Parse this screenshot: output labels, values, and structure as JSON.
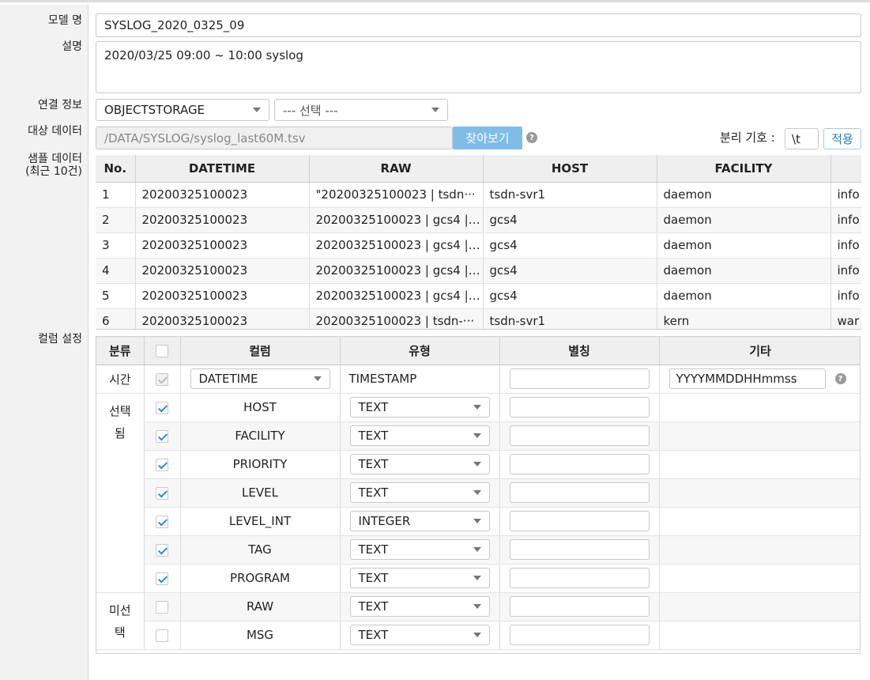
{
  "labels": {
    "model_name": "모델 명",
    "description": "설명",
    "connection": "연결 정보",
    "target_data": "대상 데이터",
    "sample_data_1": "샘플 데이터",
    "sample_data_2": "(최근 10건)",
    "column_settings": "컬럼 설정"
  },
  "form": {
    "model_name_value": "SYSLOG_2020_0325_09",
    "description_value": "2020/03/25 09:00 ~ 10:00 syslog",
    "connection_type": "OBJECTSTORAGE",
    "connection_select": "--- 선택 ---",
    "target_path": "/DATA/SYSLOG/syslog_last60M.tsv",
    "browse_button": "찾아보기",
    "help_glyph": "?",
    "delimiter_label": "분리 기호 :",
    "delimiter_value": "\\t",
    "apply_button": "적용"
  },
  "sample_table": {
    "headers": [
      "No.",
      "DATETIME",
      "RAW",
      "HOST",
      "FACILITY",
      ""
    ],
    "rows": [
      [
        "1",
        "20200325100023",
        "\"20200325100023 | tsdn···",
        "tsdn-svr1",
        "daemon",
        "info"
      ],
      [
        "2",
        "20200325100023",
        "20200325100023 | gcs4 | ···",
        "gcs4",
        "daemon",
        "info"
      ],
      [
        "3",
        "20200325100023",
        "20200325100023 | gcs4 | ···",
        "gcs4",
        "daemon",
        "info"
      ],
      [
        "4",
        "20200325100023",
        "20200325100023 | gcs4 | ···",
        "gcs4",
        "daemon",
        "info"
      ],
      [
        "5",
        "20200325100023",
        "20200325100023 | gcs4 | ···",
        "gcs4",
        "daemon",
        "info"
      ],
      [
        "6",
        "20200325100023",
        "20200325100023 | tsdn-···",
        "tsdn-svr1",
        "kern",
        "war"
      ]
    ]
  },
  "columns_table": {
    "headers": [
      "분류",
      "",
      "컬럼",
      "유형",
      "별칭",
      "기타"
    ],
    "time_category": "시간",
    "time_column": "DATETIME",
    "time_type": "TIMESTAMP",
    "time_format": "YYYYMMDDHHmmss",
    "selected_category_1": "선택",
    "selected_category_2": "됨",
    "unselected_category_1": "미선",
    "unselected_category_2": "택",
    "selected_rows": [
      {
        "name": "HOST",
        "type": "TEXT"
      },
      {
        "name": "FACILITY",
        "type": "TEXT"
      },
      {
        "name": "PRIORITY",
        "type": "TEXT"
      },
      {
        "name": "LEVEL",
        "type": "TEXT"
      },
      {
        "name": "LEVEL_INT",
        "type": "INTEGER"
      },
      {
        "name": "TAG",
        "type": "TEXT"
      },
      {
        "name": "PROGRAM",
        "type": "TEXT"
      }
    ],
    "unselected_rows": [
      {
        "name": "RAW",
        "type": "TEXT"
      },
      {
        "name": "MSG",
        "type": "TEXT"
      }
    ]
  }
}
